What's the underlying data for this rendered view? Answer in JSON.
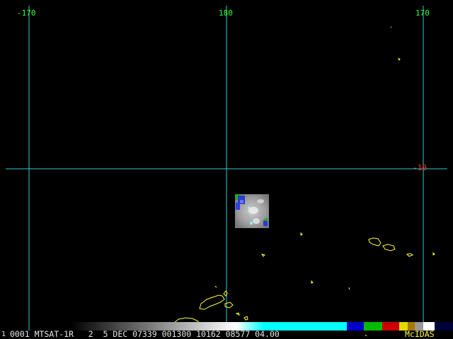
{
  "grid": {
    "longitude_labels": [
      "-170",
      "180",
      "170"
    ],
    "latitude_labels": [
      "-10"
    ]
  },
  "status": {
    "frame_number": "1",
    "text": "0001 MTSAT-1R   2  5 DEC 07339 001300 10162 08577 04.00",
    "product": "McIDAS"
  },
  "colors": {
    "grid_line": "#33cccc",
    "longitude_label": "#33ff33",
    "latitude_label": "#ff3333",
    "coastline": "#ffff33",
    "status_text": "#e6e6e6",
    "product_label": "#ffff33"
  },
  "icons": {
    "map": "map-icon"
  }
}
